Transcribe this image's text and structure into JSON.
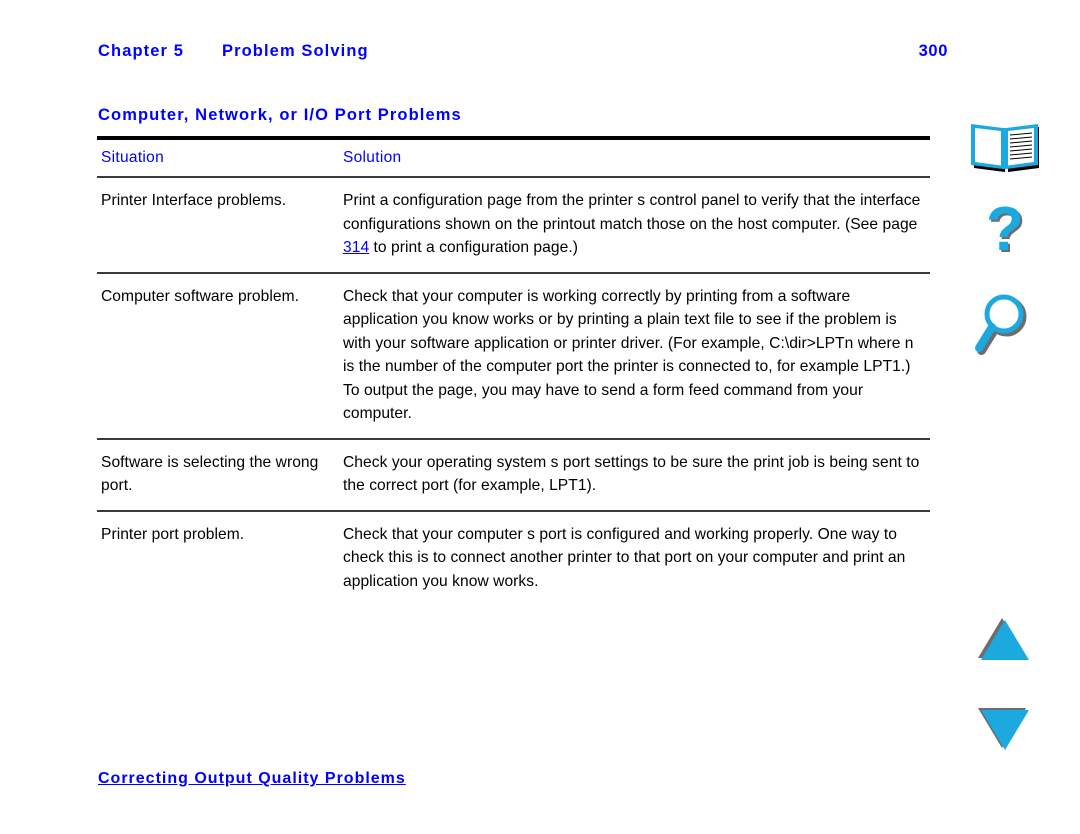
{
  "document": {
    "header": {
      "chapter_label": "Chapter 5",
      "chapter_title": "Problem Solving",
      "page_number": "300"
    },
    "section_heading": "Computer, Network, or I/O Port Problems",
    "footer_link": "Correcting Output Quality Problems"
  },
  "table": {
    "columns": [
      {
        "header": "Situation"
      },
      {
        "header": "Solution"
      }
    ],
    "rows": [
      {
        "situation": "Printer Interface problems.",
        "solution_part1": "Print a configuration page from the printer s control panel to verify that the interface configurations shown on the printout match those on the host computer. (See page ",
        "solution_link": "314",
        "solution_part2": " to print a configuration page.)"
      },
      {
        "situation": "Computer software problem.",
        "solution": "Check that your computer is working correctly by printing from a software application you know works or by printing a plain text file to see if the problem is with your software application or printer driver. (For example, C:\\dir>LPTn where n is the number of the computer port the printer is connected to, for example LPT1.) To output the page, you may have to send a form feed command from your computer."
      },
      {
        "situation": "Software is selecting the wrong port.",
        "solution": "Check your operating system s port settings to be sure the print job is being sent to the correct port (for example, LPT1)."
      },
      {
        "situation": "Printer port problem.",
        "solution": "Check that your computer s port is configured and working properly. One way to check this is to connect another printer to that port on your computer and print an application you know works."
      }
    ]
  },
  "nav_icons": [
    {
      "name": "book-icon",
      "label": "Contents"
    },
    {
      "name": "help-icon",
      "label": "Help"
    },
    {
      "name": "search-icon",
      "label": "Search"
    },
    {
      "name": "up-arrow-icon",
      "label": "Previous Page"
    },
    {
      "name": "down-arrow-icon",
      "label": "Next Page"
    }
  ],
  "colors": {
    "link_blue": "#0000FF",
    "icon_cyan": "#00A8E8",
    "icon_shadow": "#808080",
    "rule_black": "#000000",
    "text_black": "#000000"
  }
}
